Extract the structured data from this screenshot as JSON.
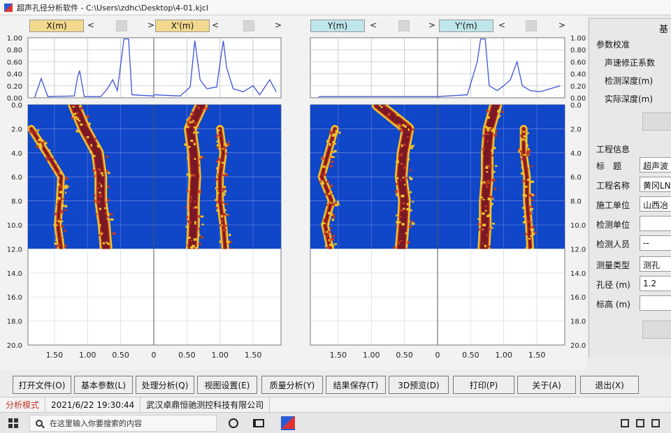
{
  "window": {
    "title": "超声孔径分析软件 - C:\\Users\\zdhc\\Desktop\\4-01.kjcl"
  },
  "channels": {
    "left_a": "X(m)",
    "left_b": "X'(m)",
    "right_a": "Y(m)",
    "right_b": "Y'(m)",
    "prev": "<",
    "next": ">"
  },
  "colors": {
    "scan_background": "#1046c8",
    "signal_core": "#7a1826",
    "signal_mid": "#c13a22",
    "signal_edge": "#f0c42a",
    "waveform": "#3c54d8",
    "channel_x": "#f3d98d",
    "channel_y": "#bfe6ea",
    "mode_text": "#c3352b"
  },
  "chart_data": {
    "type": "heatmap",
    "waveform_axis": {
      "ylim": [
        0,
        1
      ],
      "yticks": [
        "1.00",
        "0.80",
        "0.60",
        "0.40",
        "0.20",
        "0.00"
      ]
    },
    "depth_axis": {
      "ylim": [
        0,
        20
      ],
      "left_ticks": [
        "0.0",
        "2.0",
        "4.0",
        "6.0",
        "8.0",
        "10.0",
        "12.0",
        "14.0",
        "16.0",
        "18.0",
        "20.0"
      ],
      "right_ticks": [
        "0.0",
        "2.0",
        "4.0",
        "6.0",
        "8.0",
        "10.0",
        "12.0",
        "14.0",
        "16.0",
        "18.0",
        "20.0"
      ],
      "scanned_to": 12.0
    },
    "distance_axis": {
      "left_ticks": [
        "1.50",
        "1.00",
        "0.50",
        "0",
        "0.50",
        "1.00",
        "1.50"
      ],
      "right_ticks": [
        "1.50",
        "1.00",
        "0.50",
        "0",
        "0.50",
        "1.00",
        "1.50"
      ]
    },
    "panels": [
      {
        "name": "X",
        "waveform": [
          [
            -1.8,
            0.0
          ],
          [
            -1.7,
            0.32
          ],
          [
            -1.6,
            0.02
          ],
          [
            -1.2,
            0.03
          ],
          [
            -1.15,
            0.35
          ],
          [
            -1.12,
            0.45
          ],
          [
            -1.05,
            0.02
          ],
          [
            -0.8,
            0.02
          ],
          [
            -0.7,
            0.15
          ],
          [
            -0.62,
            0.3
          ],
          [
            -0.55,
            0.12
          ],
          [
            -0.45,
            0.98
          ],
          [
            -0.38,
            0.98
          ],
          [
            -0.33,
            0.05
          ],
          [
            0,
            0.03
          ]
        ],
        "wall": [
          [
            0,
            1.2
          ],
          [
            2,
            1.05
          ],
          [
            4,
            0.85
          ],
          [
            6,
            0.8
          ],
          [
            8,
            0.8
          ],
          [
            10,
            0.75
          ],
          [
            12,
            0.72
          ]
        ],
        "secondary": [
          [
            2,
            1.85
          ],
          [
            4,
            1.62
          ],
          [
            6,
            1.4
          ],
          [
            8,
            1.42
          ],
          [
            10,
            1.45
          ],
          [
            12,
            1.4
          ]
        ]
      },
      {
        "name": "X'",
        "waveform": [
          [
            0,
            0.05
          ],
          [
            0.4,
            0.03
          ],
          [
            0.55,
            0.18
          ],
          [
            0.62,
            0.95
          ],
          [
            0.7,
            0.3
          ],
          [
            0.8,
            0.15
          ],
          [
            0.95,
            0.18
          ],
          [
            1.05,
            0.95
          ],
          [
            1.1,
            0.5
          ],
          [
            1.2,
            0.15
          ],
          [
            1.35,
            0.1
          ],
          [
            1.5,
            0.2
          ],
          [
            1.6,
            0.05
          ],
          [
            1.75,
            0.3
          ],
          [
            1.85,
            0.1
          ]
        ],
        "wall": [
          [
            0,
            0.72
          ],
          [
            2,
            0.55
          ],
          [
            4,
            0.6
          ],
          [
            6,
            0.62
          ],
          [
            8,
            0.6
          ],
          [
            10,
            0.6
          ],
          [
            12,
            0.58
          ]
        ],
        "secondary": [
          [
            2,
            1.0
          ],
          [
            4,
            1.05
          ],
          [
            6,
            1.0
          ],
          [
            8,
            1.0
          ],
          [
            10,
            1.05
          ],
          [
            12,
            1.08
          ]
        ]
      },
      {
        "name": "Y",
        "waveform": [
          [
            -1.8,
            0.02
          ],
          [
            0,
            0.02
          ]
        ],
        "wall": [
          [
            0,
            0.9
          ],
          [
            2,
            0.45
          ],
          [
            4,
            0.52
          ],
          [
            6,
            0.55
          ],
          [
            8,
            0.5
          ],
          [
            10,
            0.52
          ],
          [
            12,
            0.55
          ]
        ],
        "secondary": [
          [
            2,
            1.55
          ],
          [
            6,
            1.75
          ],
          [
            8,
            1.6
          ],
          [
            10,
            1.7
          ],
          [
            12,
            1.62
          ]
        ]
      },
      {
        "name": "Y'",
        "waveform": [
          [
            0,
            0.02
          ],
          [
            0.45,
            0.05
          ],
          [
            0.6,
            0.6
          ],
          [
            0.65,
            0.98
          ],
          [
            0.72,
            0.98
          ],
          [
            0.78,
            0.2
          ],
          [
            0.9,
            0.12
          ],
          [
            1.0,
            0.2
          ],
          [
            1.1,
            0.3
          ],
          [
            1.2,
            0.6
          ],
          [
            1.28,
            0.2
          ],
          [
            1.4,
            0.12
          ],
          [
            1.55,
            0.1
          ],
          [
            1.7,
            0.15
          ],
          [
            1.85,
            0.2
          ]
        ],
        "wall": [
          [
            0,
            0.88
          ],
          [
            2,
            0.78
          ],
          [
            4,
            0.75
          ],
          [
            6,
            0.75
          ],
          [
            8,
            0.72
          ],
          [
            10,
            0.72
          ],
          [
            12,
            0.7
          ]
        ],
        "secondary": [
          [
            2,
            1.3
          ],
          [
            4,
            1.3
          ],
          [
            6,
            1.35
          ],
          [
            8,
            1.35
          ],
          [
            10,
            1.38
          ],
          [
            12,
            1.4
          ]
        ]
      }
    ]
  },
  "panel": {
    "tab_title": "基",
    "calib_title": "参数校准",
    "sound_speed": "声速修正系数",
    "detect_depth": "检测深度(m)",
    "actual_depth": "实际深度(m)",
    "project_info": "工程信息",
    "title_label": "标　题",
    "title_value": "超声波",
    "project_name_label": "工程名称",
    "project_name_value": "黄冈LN",
    "construct_unit_label": "施工单位",
    "construct_unit_value": "山西冶",
    "inspect_unit_label": "检测单位",
    "inspect_unit_value": "",
    "inspector_label": "检测人员",
    "inspector_value": "--",
    "measure_type_label": "测量类型",
    "measure_type_value": "测孔",
    "hole_dia_label": "孔径 (m)",
    "hole_dia_value": "1.2",
    "elevation_label": "标高 (m)",
    "elevation_value": ""
  },
  "toolbar": {
    "open": "打开文件(O)",
    "params": "基本参数(L)",
    "process": "处理分析(Q)",
    "view": "视图设置(E)",
    "quality": "质量分析(Y)",
    "save": "结果保存(T)",
    "preview3d": "3D预览(D)",
    "print": "打印(P)",
    "about": "关于(A)",
    "exit": "退出(X)"
  },
  "status": {
    "mode": "分析模式",
    "datetime": "2021/6/22 19:30:44",
    "company": "武汉卓鼎恒驰测控科技有限公司"
  },
  "taskbar": {
    "search_placeholder": "在这里输入你要搜索的内容"
  }
}
